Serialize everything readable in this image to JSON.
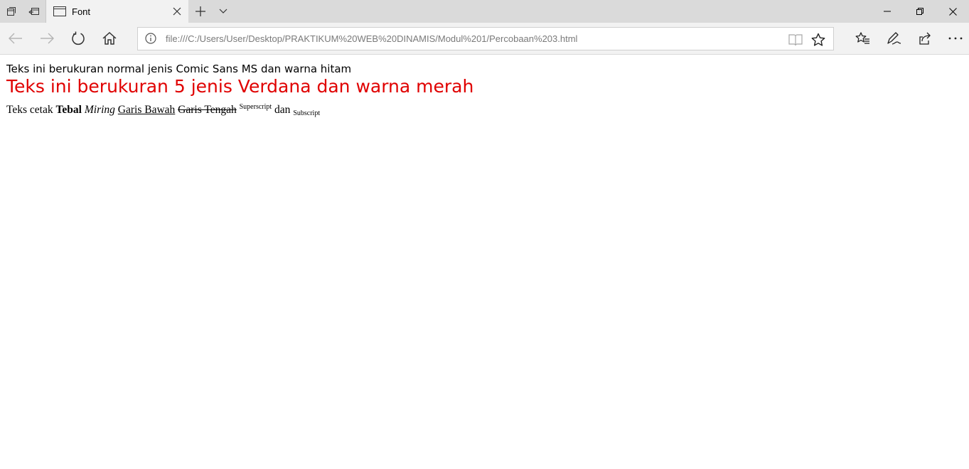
{
  "browser": {
    "tab_title": "Font",
    "address": "file:///C:/Users/User/Desktop/PRAKTIKUM%20WEB%20DINAMIS/Modul%201/Percobaan%203.html",
    "icons": {
      "tab_manager": "tab-manager-icon",
      "set_aside": "set-aside-tabs-icon",
      "page": "page-icon",
      "close_tab": "close-icon",
      "new_tab": "plus-icon",
      "tab_menu": "chevron-down-icon",
      "minimize": "minimize-icon",
      "restore": "restore-icon",
      "close_window": "close-icon",
      "back": "back-arrow-icon",
      "forward": "forward-arrow-icon",
      "refresh": "refresh-icon",
      "home": "home-icon",
      "info": "info-icon",
      "reading_view": "reading-view-icon",
      "favorite": "star-icon",
      "favorites_hub": "favorites-hub-icon",
      "notes": "pen-icon",
      "share": "share-icon",
      "more": "more-icon"
    }
  },
  "page": {
    "line1": "Teks ini berukuran normal jenis Comic Sans MS dan warna hitam",
    "line2": "Teks ini berukuran 5 jenis Verdana dan warna merah",
    "line3": {
      "prefix": "Teks cetak ",
      "bold": "Tebal",
      "italic": "Miring",
      "underline": "Garis Bawah",
      "strike": "Garis Tengah",
      "superscript": "Superscript",
      "and": "dan",
      "subscript": "Subscript"
    },
    "colors": {
      "line2": "#e00000",
      "line1": "#000000"
    }
  }
}
